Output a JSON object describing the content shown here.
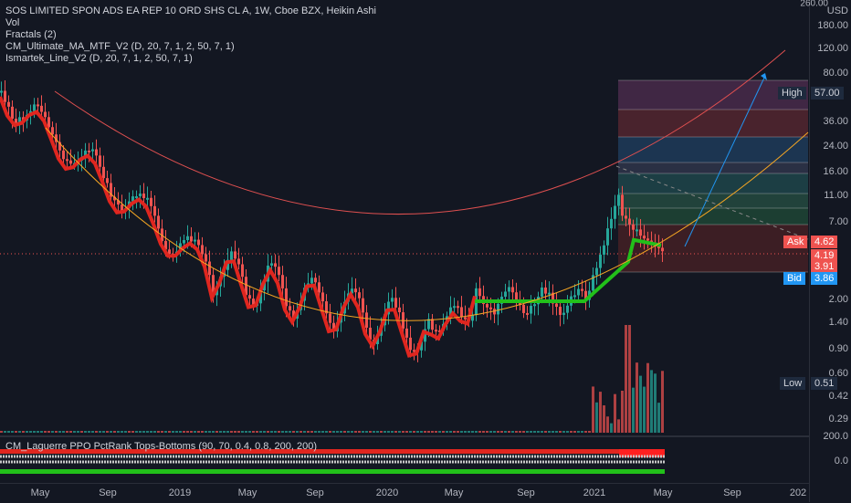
{
  "legend": {
    "title": "SOS LIMITED SPON ADS EA REP 10 ORD SHS CL A, 1W, Cboe BZX, Heikin Ashi",
    "vol": "Vol",
    "fractals": "Fractals (2)",
    "ma": "CM_Ultimate_MA_MTF_V2 (D, 20, 7, 1, 2, 50, 7, 1)",
    "ismartek": "Ismartek_Line_V2 (D, 20, 7, 1, 2, 50, 7, 1)"
  },
  "price_axis": {
    "currency": "USD",
    "ticks": [
      "260.00",
      "180.00",
      "120.00",
      "80.00",
      "36.00",
      "24.00",
      "16.00",
      "11.00",
      "7.00",
      "2.00",
      "1.40",
      "0.90",
      "0.60",
      "0.42",
      "0.29"
    ],
    "partial_top": "260.00"
  },
  "badges": {
    "high_label": "High",
    "high_value": "57.00",
    "ask_label": "Ask",
    "ask_value": "4.62",
    "last_value": "4.19",
    "third_value": "3.91",
    "bid_label": "Bid",
    "bid_value": "3.86",
    "low_label": "Low",
    "low_value": "0.51"
  },
  "oscillator": {
    "label": "CM_Laguerre PPO PctRank Tops-Bottoms (90, 70, 0.4, 0.8, 200, 200)",
    "ticks": [
      "200.0",
      "0.0"
    ]
  },
  "time_axis": [
    "May",
    "Sep",
    "2019",
    "May",
    "Sep",
    "2020",
    "May",
    "Sep",
    "2021",
    "May",
    "Sep",
    "202"
  ],
  "colors": {
    "up": "#26a69a",
    "down": "#ef5350",
    "ma_down": "#e0261f",
    "ma_up": "#22c01a",
    "background": "#131722"
  }
}
